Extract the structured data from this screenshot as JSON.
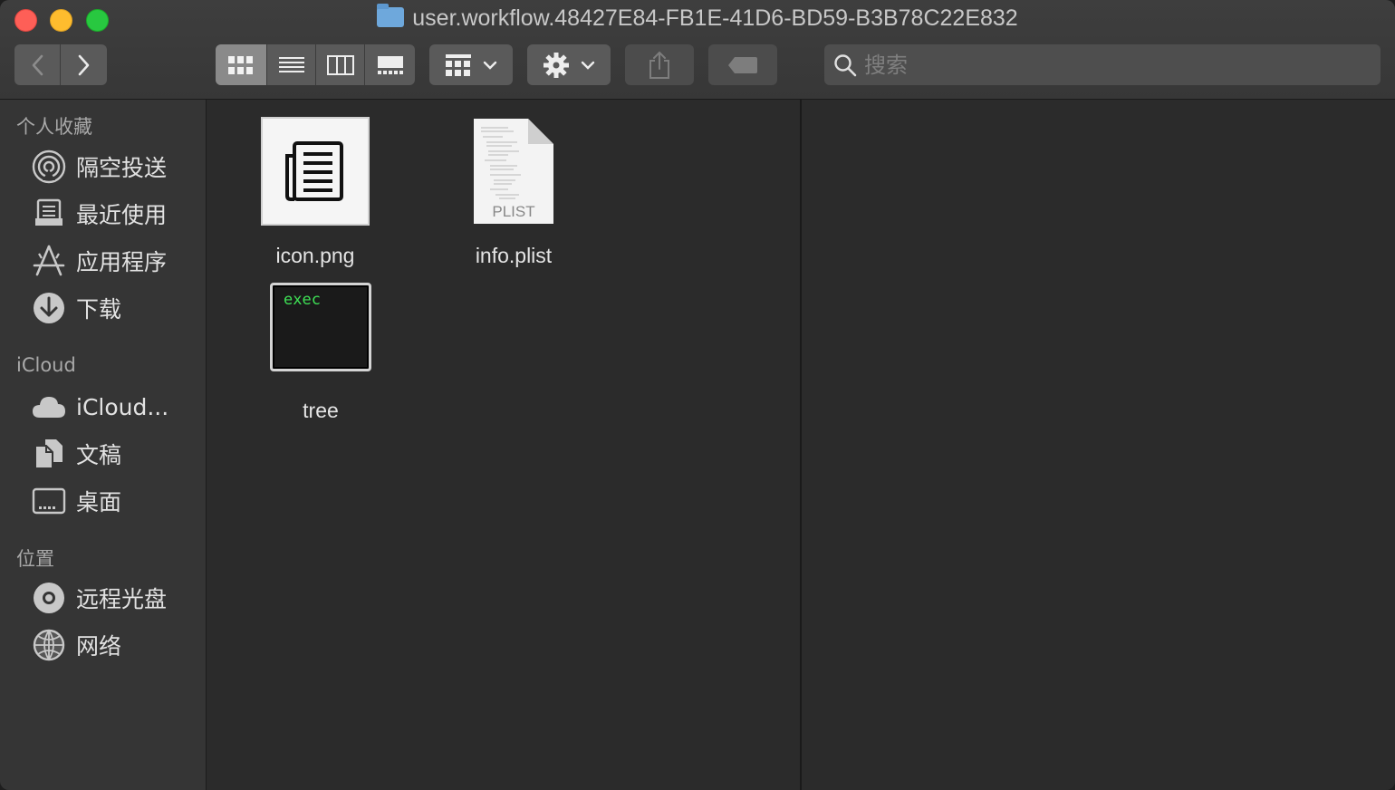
{
  "window": {
    "title": "user.workflow.48427E84-FB1E-41D6-BD59-B3B78C22E832"
  },
  "toolbar": {
    "search_placeholder": "搜索",
    "view_mode_selected": "icon-view"
  },
  "sidebar": {
    "sections": [
      {
        "title": "个人收藏",
        "items": [
          {
            "label": "隔空投送",
            "icon": "airdrop-icon"
          },
          {
            "label": "最近使用",
            "icon": "recents-icon"
          },
          {
            "label": "应用程序",
            "icon": "applications-icon"
          },
          {
            "label": "下载",
            "icon": "downloads-icon"
          }
        ]
      },
      {
        "title": "iCloud",
        "items": [
          {
            "label": "iCloud...",
            "icon": "icloud-icon"
          },
          {
            "label": "文稿",
            "icon": "documents-icon"
          },
          {
            "label": "桌面",
            "icon": "desktop-icon"
          }
        ]
      },
      {
        "title": "位置",
        "items": [
          {
            "label": "远程光盘",
            "icon": "remote-disc-icon"
          },
          {
            "label": "网络",
            "icon": "network-icon"
          }
        ]
      }
    ]
  },
  "files": [
    {
      "name": "icon.png",
      "kind": "image",
      "icon": "document-list-icon"
    },
    {
      "name": "info.plist",
      "kind": "plist",
      "badge": "PLIST",
      "icon": "plist-file-icon"
    },
    {
      "name": "tree",
      "kind": "executable",
      "badge": "exec",
      "icon": "terminal-exec-icon"
    }
  ],
  "colors": {
    "close": "#fe5f57",
    "minimize": "#febc2e",
    "zoom": "#28c840",
    "exec_text": "#3ee055"
  }
}
